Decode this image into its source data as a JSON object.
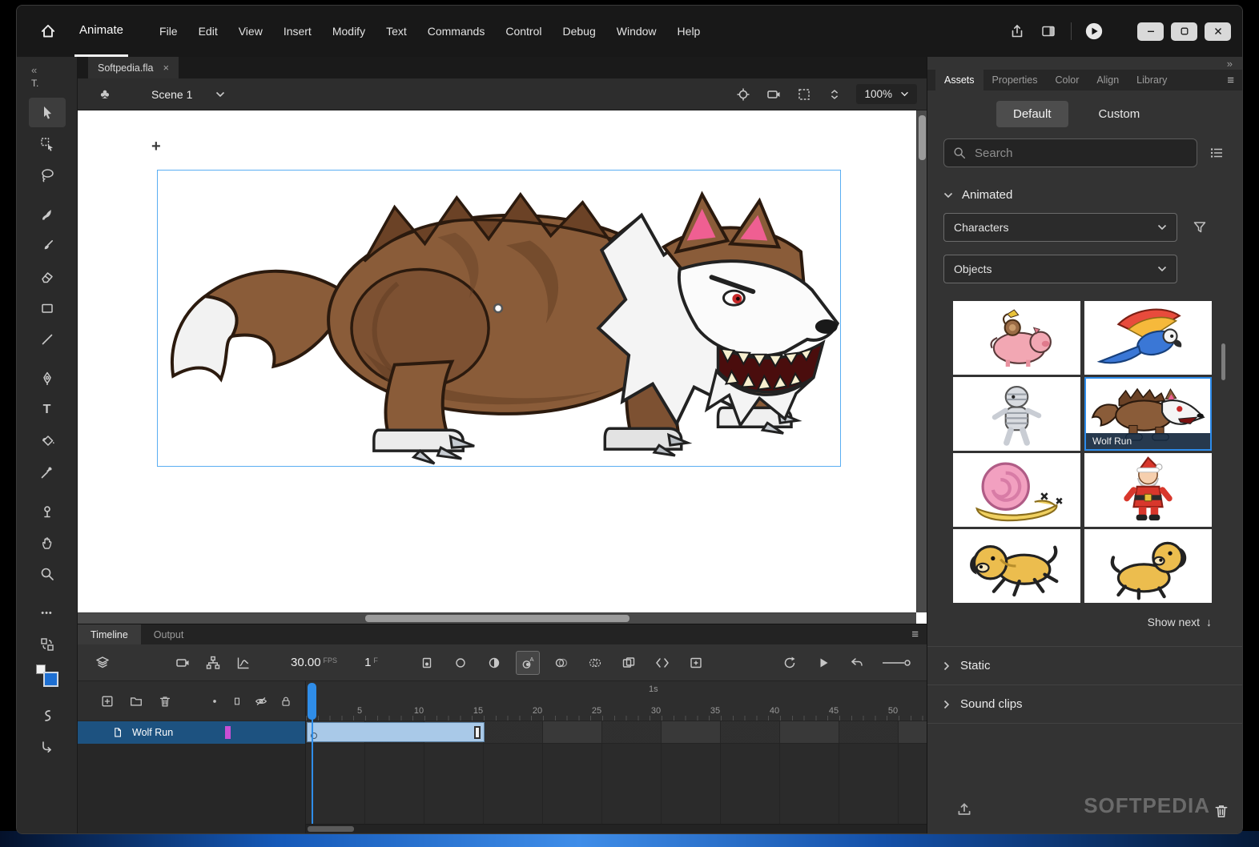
{
  "glyphs": {
    "collapse": "«",
    "expand": "»",
    "hamburger": "≡",
    "close": "×",
    "clover": "♣",
    "registration": "+",
    "ellipsis": "•••",
    "text_tool": "T",
    "down_arrow": "↓",
    "tools_title": "T."
  },
  "titlebar": {
    "app_tab": "Animate",
    "menus": [
      "File",
      "Edit",
      "View",
      "Insert",
      "Modify",
      "Text",
      "Commands",
      "Control",
      "Debug",
      "Window",
      "Help"
    ]
  },
  "document": {
    "tab_title": "Softpedia.fla"
  },
  "scene_bar": {
    "scene_name": "Scene 1",
    "zoom_value": "100%"
  },
  "timeline": {
    "tab_timeline": "Timeline",
    "tab_output": "Output",
    "fps_value": "30.00",
    "fps_unit": "FPS",
    "frame_value": "1",
    "frame_unit": "F",
    "second_marker": "1s",
    "ruler_numbers": [
      "5",
      "10",
      "15",
      "20",
      "25",
      "30",
      "35",
      "40",
      "45",
      "50"
    ],
    "layer_name": "Wolf Run"
  },
  "assets_panel": {
    "tabs": [
      "Assets",
      "Properties",
      "Color",
      "Align",
      "Library"
    ],
    "mode_default": "Default",
    "mode_custom": "Custom",
    "search_placeholder": "Search",
    "section_animated": "Animated",
    "dropdown_characters": "Characters",
    "dropdown_objects": "Objects",
    "selected_asset": "Wolf Run",
    "show_next": "Show next",
    "section_static": "Static",
    "section_sound_clips": "Sound clips",
    "watermark": "SOFTPEDIA"
  }
}
